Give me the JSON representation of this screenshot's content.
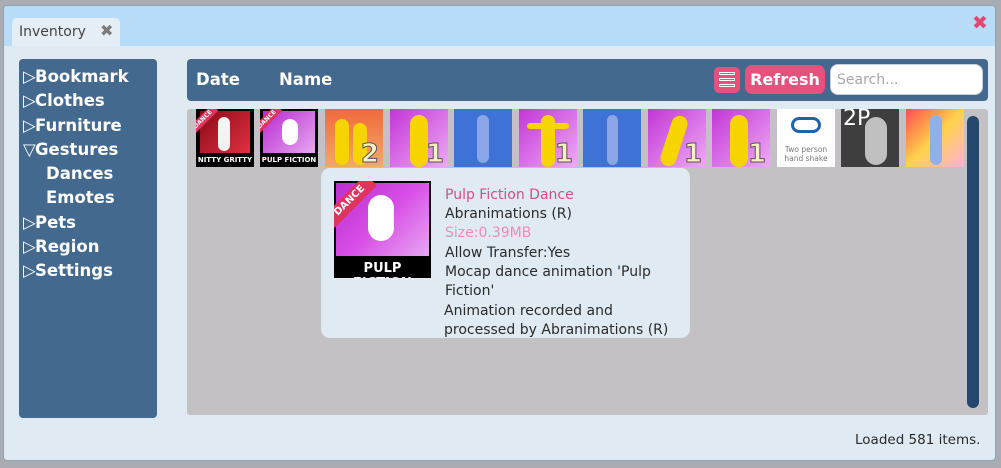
{
  "window": {
    "tab_label": "Inventory",
    "close_symbol": "✖",
    "colors": {
      "titlebar": "#b8dcf8",
      "panel": "#44698f",
      "accent": "#e8517e"
    }
  },
  "sidebar": {
    "items": [
      {
        "label": "Bookmark",
        "arrow": "▷"
      },
      {
        "label": "Clothes",
        "arrow": "▷"
      },
      {
        "label": "Furniture",
        "arrow": "▷"
      },
      {
        "label": "Gestures",
        "arrow": "▽"
      },
      {
        "label": "Dances",
        "arrow": ""
      },
      {
        "label": "Emotes",
        "arrow": ""
      },
      {
        "label": "Pets",
        "arrow": "▷"
      },
      {
        "label": "Region",
        "arrow": "▷"
      },
      {
        "label": "Settings",
        "arrow": "▷"
      }
    ]
  },
  "header": {
    "col_date": "Date",
    "col_name": "Name",
    "list_view_icon": "list-view-icon",
    "refresh_label": "Refresh",
    "search_placeholder": "Search..."
  },
  "items": [
    {
      "label": "NITTY GRITTY",
      "badge": "DANCE",
      "count": ""
    },
    {
      "label": "PULP FICTION",
      "badge": "DANCE",
      "count": ""
    },
    {
      "label": "",
      "badge": "",
      "count": "2"
    },
    {
      "label": "",
      "badge": "",
      "count": "1"
    },
    {
      "label": "",
      "badge": "",
      "count": ""
    },
    {
      "label": "",
      "badge": "",
      "count": "1"
    },
    {
      "label": "",
      "badge": "",
      "count": ""
    },
    {
      "label": "",
      "badge": "",
      "count": "1"
    },
    {
      "label": "",
      "badge": "",
      "count": "1"
    },
    {
      "label": "Two person hand shake",
      "badge": "",
      "count": ""
    },
    {
      "label": "2P",
      "badge": "",
      "count": ""
    },
    {
      "label": "",
      "badge": "",
      "count": ""
    }
  ],
  "tooltip": {
    "badge": "DANCE",
    "caption": "PULP FICTION",
    "title": "Pulp Fiction Dance",
    "creator": "Abranimations (R)",
    "size": "Size:0.39MB",
    "transfer": "Allow Transfer:Yes",
    "desc1": "Mocap dance animation 'Pulp",
    "desc2": "Fiction'",
    "desc3": "Animation recorded and",
    "desc4": "processed by Abranimations (R)"
  },
  "status": {
    "text": "Loaded 581 items."
  }
}
